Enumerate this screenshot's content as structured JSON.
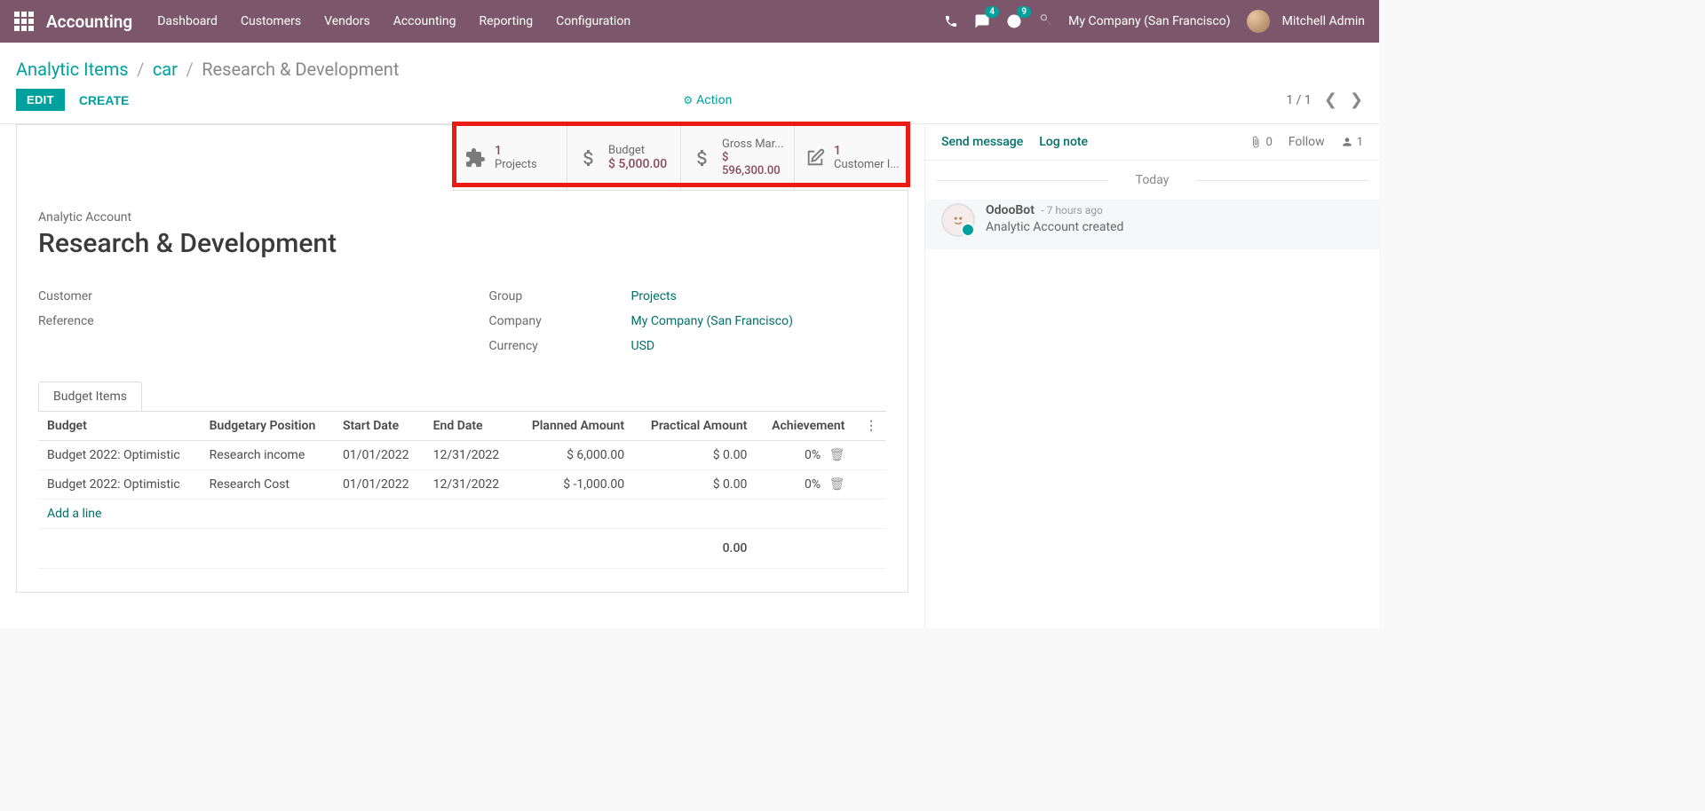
{
  "header": {
    "app": "Accounting",
    "nav": [
      "Dashboard",
      "Customers",
      "Vendors",
      "Accounting",
      "Reporting",
      "Configuration"
    ],
    "msg_badge": "4",
    "act_badge": "9",
    "company": "My Company (San Francisco)",
    "user": "Mitchell Admin"
  },
  "breadcrumb": {
    "a": "Analytic Items",
    "b": "car",
    "cur": "Research & Development"
  },
  "actions": {
    "edit": "EDIT",
    "create": "CREATE",
    "action": "Action",
    "pager": "1 / 1"
  },
  "stats": {
    "projects_n": "1",
    "projects_l": "Projects",
    "budget_l": "Budget",
    "budget_v": "$ 5,000.00",
    "gross_l": "Gross Mar...",
    "gross_v": "$ 596,300.00",
    "cust_n": "1",
    "cust_l": "Customer I..."
  },
  "record": {
    "small": "Analytic Account",
    "title": "Research & Development",
    "customer_l": "Customer",
    "customer_v": "",
    "reference_l": "Reference",
    "reference_v": "",
    "group_l": "Group",
    "group_v": "Projects",
    "company_l": "Company",
    "company_v": "My Company (San Francisco)",
    "currency_l": "Currency",
    "currency_v": "USD"
  },
  "tab": "Budget Items",
  "table": {
    "cols": {
      "budget": "Budget",
      "pos": "Budgetary Position",
      "start": "Start Date",
      "end": "End Date",
      "planned": "Planned Amount",
      "practical": "Practical Amount",
      "ach": "Achievement"
    },
    "rows": [
      {
        "budget": "Budget 2022: Optimistic",
        "pos": "Research income",
        "start": "01/01/2022",
        "end": "12/31/2022",
        "planned": "$ 6,000.00",
        "practical": "$ 0.00",
        "ach": "0%"
      },
      {
        "budget": "Budget 2022: Optimistic",
        "pos": "Research Cost",
        "start": "01/01/2022",
        "end": "12/31/2022",
        "planned": "$ -1,000.00",
        "practical": "$ 0.00",
        "ach": "0%"
      }
    ],
    "addline": "Add a line",
    "foot_practical": "0.00"
  },
  "chatter": {
    "send": "Send message",
    "log": "Log note",
    "attach_n": "0",
    "follow": "Follow",
    "followers_n": "1",
    "today": "Today",
    "msg_who": "OdooBot",
    "msg_when": "- 7 hours ago",
    "msg_txt": "Analytic Account created"
  }
}
